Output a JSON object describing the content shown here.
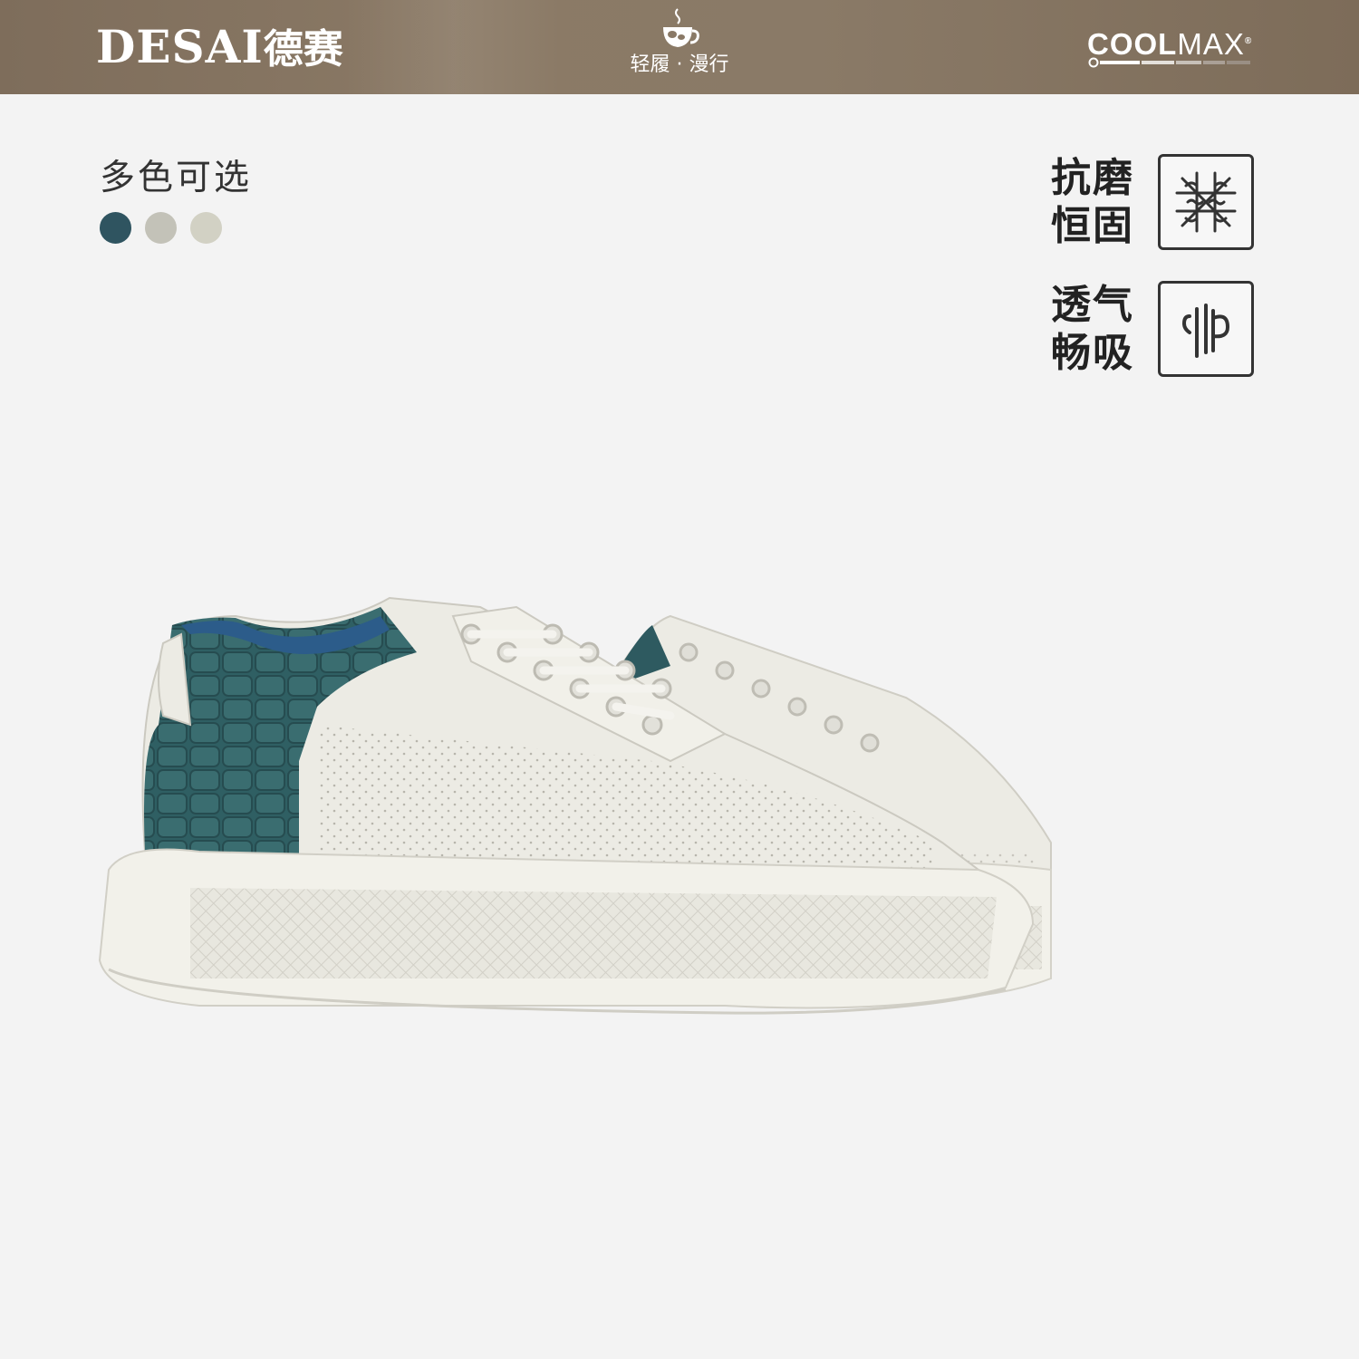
{
  "header": {
    "brand_latin": "DESAI",
    "brand_cn": "德赛",
    "tagline": "轻履 · 漫行",
    "tech_logo_bold": "COOL",
    "tech_logo_light": "MAX",
    "tech_logo_mark": "®",
    "center_icon": "tea-cup-logo-icon"
  },
  "colors": {
    "heading": "多色可选",
    "options": [
      {
        "name": "teal-blue",
        "hex": "#2f5460"
      },
      {
        "name": "grey-beige",
        "hex": "#c3c2b8"
      },
      {
        "name": "light-beige",
        "hex": "#d2d1c4"
      }
    ]
  },
  "features": [
    {
      "line1": "抗磨",
      "line2": "恒固",
      "icon": "fiber-network-icon"
    },
    {
      "line1": "透气",
      "line2": "畅吸",
      "icon": "airflow-icon"
    }
  ],
  "product": {
    "image": "white-sneaker-teal-croc-heel-illustration",
    "accent_color": "#2e5a60",
    "upper_color": "#ecebe4"
  }
}
